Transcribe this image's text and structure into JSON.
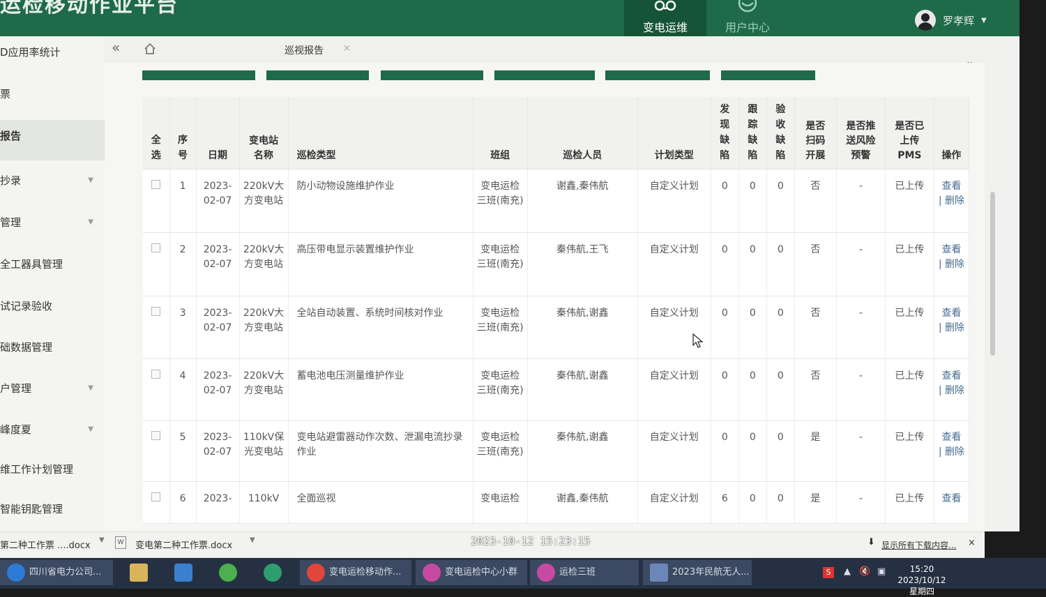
{
  "header": {
    "app_title": "运检移动作业平台",
    "nav": [
      {
        "label": "变电运维",
        "icon": "substation-ops-icon"
      },
      {
        "label": "用户中心",
        "icon": "user-center-icon"
      }
    ],
    "user_name": "罗孝辉"
  },
  "sidebar": {
    "items": [
      {
        "label": "D应用率统计",
        "has_arrow": false
      },
      {
        "label": "票",
        "has_arrow": false
      },
      {
        "label": "报告",
        "has_arrow": false,
        "active": true
      },
      {
        "label": "抄录",
        "has_arrow": true
      },
      {
        "label": "管理",
        "has_arrow": true
      },
      {
        "label": "全工器具管理",
        "has_arrow": false
      },
      {
        "label": "试记录验收",
        "has_arrow": false
      },
      {
        "label": "础数据管理",
        "has_arrow": false
      },
      {
        "label": "户管理",
        "has_arrow": true
      },
      {
        "label": "峰度夏",
        "has_arrow": true
      },
      {
        "label": "维工作计划管理",
        "has_arrow": false
      },
      {
        "label": "智能钥匙管理",
        "has_arrow": false
      }
    ]
  },
  "tabs": {
    "collapse": "«",
    "current": "巡视报告",
    "close": "×",
    "more_right": "»",
    "more_down": "⌄"
  },
  "table": {
    "headers": {
      "select_all": "全选",
      "index": "序号",
      "date": "日期",
      "station": "变电站名称",
      "type": "巡检类型",
      "team": "班组",
      "inspectors": "巡检人员",
      "plan_type": "计划类型",
      "found": "发现缺陷",
      "tracked": "跟踪缺陷",
      "accepted": "验收缺陷",
      "scan": "是否扫码开展",
      "risk": "是否推送风险预警",
      "pms": "是否已上传PMS",
      "ops": "操作"
    },
    "rows": [
      {
        "index": "1",
        "date": "2023-02-07",
        "station": "220kV大方变电站",
        "type": "防小动物设施维护作业",
        "team": "变电运检三班(南充)",
        "inspectors": "谢鑫,秦伟航",
        "plan": "自定义计划",
        "found": "0",
        "tracked": "0",
        "accepted": "0",
        "scan": "否",
        "risk": "-",
        "pms": "已上传",
        "view": "查看",
        "delete": "删除"
      },
      {
        "index": "2",
        "date": "2023-02-07",
        "station": "220kV大方变电站",
        "type": "高压带电显示装置维护作业",
        "team": "变电运检三班(南充)",
        "inspectors": "秦伟航,王飞",
        "plan": "自定义计划",
        "found": "0",
        "tracked": "0",
        "accepted": "0",
        "scan": "否",
        "risk": "-",
        "pms": "已上传",
        "view": "查看",
        "delete": "删除"
      },
      {
        "index": "3",
        "date": "2023-02-07",
        "station": "220kV大方变电站",
        "type": "全站自动装置、系统时间核对作业",
        "team": "变电运检三班(南充)",
        "inspectors": "秦伟航,谢鑫",
        "plan": "自定义计划",
        "found": "0",
        "tracked": "0",
        "accepted": "0",
        "scan": "否",
        "risk": "-",
        "pms": "已上传",
        "view": "查看",
        "delete": "删除"
      },
      {
        "index": "4",
        "date": "2023-02-07",
        "station": "220kV大方变电站",
        "type": "蓄电池电压测量维护作业",
        "team": "变电运检三班(南充)",
        "inspectors": "秦伟航,谢鑫",
        "plan": "自定义计划",
        "found": "0",
        "tracked": "0",
        "accepted": "0",
        "scan": "否",
        "risk": "-",
        "pms": "已上传",
        "view": "查看",
        "delete": "删除"
      },
      {
        "index": "5",
        "date": "2023-02-07",
        "station": "110kV保光变电站",
        "type": "变电站避雷器动作次数、泄漏电流抄录作业",
        "team": "变电运检三班(南充)",
        "inspectors": "秦伟航,谢鑫",
        "plan": "自定义计划",
        "found": "0",
        "tracked": "0",
        "accepted": "0",
        "scan": "是",
        "risk": "-",
        "pms": "已上传",
        "view": "查看",
        "delete": "删除"
      },
      {
        "index": "6",
        "date": "2023-",
        "station": "110kV",
        "type": "全面巡视",
        "team": "变电运检",
        "inspectors": "谢鑫,秦伟航",
        "plan": "自定义计划",
        "found": "6",
        "tracked": "0",
        "accepted": "0",
        "scan": "是",
        "risk": "-",
        "pms": "已上传",
        "view": "查看",
        "delete": ""
      }
    ]
  },
  "downloads": {
    "items": [
      "第二种工作票 ....docx",
      "变电第二种工作票.docx"
    ],
    "show_all": "显示所有下载内容...",
    "close": "×"
  },
  "overlay_timestamp": "2023-10-12 15:23:15",
  "taskbar": {
    "items": [
      {
        "label": "四川省电力公司...",
        "icon_color": "#2d7bd6"
      },
      {
        "label": "",
        "icon_color": "#d9b45a"
      },
      {
        "label": "",
        "icon_color": "#3b7fd0"
      },
      {
        "label": "",
        "icon_color": "#4caf50"
      },
      {
        "label": "",
        "icon_color": "#2e9e6e"
      },
      {
        "label": "变电运检移动作...",
        "icon_color": "#e0463a"
      },
      {
        "label": "变电运检中心小群",
        "icon_color": "#c84aa0"
      },
      {
        "label": "运检三班",
        "icon_color": "#c84aa0"
      },
      {
        "label": "2023年民航无人...",
        "icon_color": "#6b86b8"
      }
    ],
    "time": "15:20",
    "date": "2023/10/12 星期四"
  },
  "colors": {
    "brand": "#1e6a49",
    "link": "#466c90",
    "taskbar": "#253142"
  }
}
